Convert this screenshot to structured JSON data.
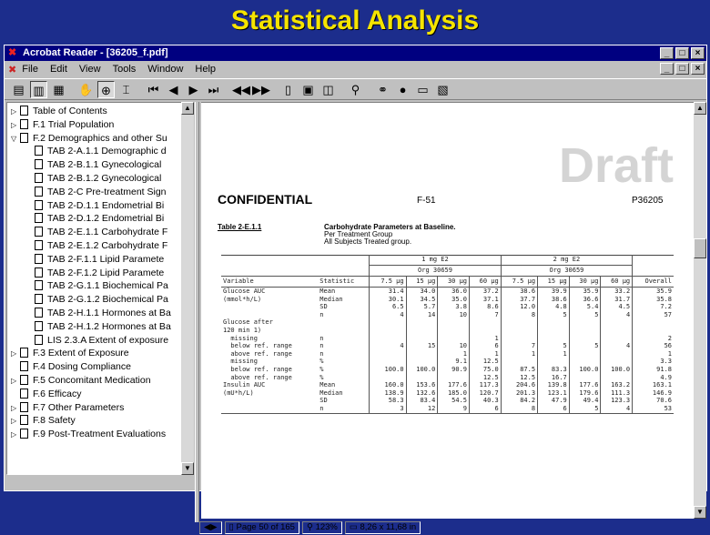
{
  "slide_title": "Statistical Analysis",
  "window": {
    "title": "Acrobat Reader - [36205_f.pdf]",
    "min_label": "_",
    "max_label": "□",
    "close_label": "×"
  },
  "menu": [
    "File",
    "Edit",
    "View",
    "Tools",
    "Window",
    "Help"
  ],
  "bookmarks": [
    {
      "label": "Table of Contents",
      "level": 0,
      "expander": "▷"
    },
    {
      "label": "F.1 Trial Population",
      "level": 0,
      "expander": "▷"
    },
    {
      "label": "F.2 Demographics and other Su",
      "level": 0,
      "expander": "▽"
    },
    {
      "label": "TAB 2-A.1.1 Demographic d",
      "level": 1,
      "expander": ""
    },
    {
      "label": "TAB 2-B.1.1 Gynecological",
      "level": 1,
      "expander": ""
    },
    {
      "label": "TAB 2-B.1.2 Gynecological",
      "level": 1,
      "expander": ""
    },
    {
      "label": "TAB 2-C Pre-treatment Sign",
      "level": 1,
      "expander": ""
    },
    {
      "label": "TAB 2-D.1.1 Endometrial Bi",
      "level": 1,
      "expander": ""
    },
    {
      "label": "TAB 2-D.1.2 Endometrial Bi",
      "level": 1,
      "expander": ""
    },
    {
      "label": "TAB 2-E.1.1 Carbohydrate F",
      "level": 1,
      "expander": ""
    },
    {
      "label": "TAB 2-E.1.2 Carbohydrate F",
      "level": 1,
      "expander": ""
    },
    {
      "label": "TAB 2-F.1.1 Lipid Paramete",
      "level": 1,
      "expander": ""
    },
    {
      "label": "TAB 2-F.1.2 Lipid Paramete",
      "level": 1,
      "expander": ""
    },
    {
      "label": "TAB 2-G.1.1 Biochemical Pa",
      "level": 1,
      "expander": ""
    },
    {
      "label": "TAB 2-G.1.2 Biochemical Pa",
      "level": 1,
      "expander": ""
    },
    {
      "label": "TAB 2-H.1.1 Hormones at Ba",
      "level": 1,
      "expander": ""
    },
    {
      "label": "TAB 2-H.1.2 Hormones at Ba",
      "level": 1,
      "expander": ""
    },
    {
      "label": "LIS 2.3.A Extent of exposure",
      "level": 1,
      "expander": ""
    },
    {
      "label": "F.3 Extent of Exposure",
      "level": 0,
      "expander": "▷"
    },
    {
      "label": "F.4 Dosing Compliance",
      "level": 0,
      "expander": ""
    },
    {
      "label": "F.5 Concomitant Medication",
      "level": 0,
      "expander": "▷"
    },
    {
      "label": "F.6 Efficacy",
      "level": 0,
      "expander": ""
    },
    {
      "label": "F.7 Other Parameters",
      "level": 0,
      "expander": "▷"
    },
    {
      "label": "F.8 Safety",
      "level": 0,
      "expander": "▷"
    },
    {
      "label": "F.9 Post-Treatment Evaluations",
      "level": 0,
      "expander": "▷"
    }
  ],
  "status": {
    "page": "Page 50 of 165",
    "zoom": "123%",
    "size": "8,26 x 11,68 in"
  },
  "doc": {
    "watermark": "Draft",
    "confidential": "CONFIDENTIAL",
    "section": "F-51",
    "study": "P36205",
    "table_id": "Table 2-E.1.1",
    "table_title": "Carbohydrate Parameters at Baseline.",
    "table_sub1": "Per Treatment Group",
    "table_sub2": "All  Subjects  Treated group.",
    "grp1_dose": "1 mg E2",
    "grp2_dose": "2 mg E2",
    "grp1_org": "Org 30659",
    "grp2_org": "Org 30659",
    "col_variable": "Variable",
    "col_statistic": "Statistic",
    "col_doses": [
      "7.5 µg",
      "15 µg",
      "30 µg",
      "60 µg",
      "7.5 µg",
      "15 µg",
      "30 µg",
      "60 µg"
    ],
    "col_overall": "Overall",
    "rows": [
      {
        "var": "Glucose AUC",
        "stat": "Mean",
        "vals": [
          "31.4",
          "34.0",
          "36.0",
          "37.2",
          "38.6",
          "39.9",
          "35.9",
          "33.2"
        ],
        "overall": "35.9"
      },
      {
        "var": "(mmol*h/L)",
        "stat": "Median",
        "vals": [
          "30.1",
          "34.5",
          "35.0",
          "37.1",
          "37.7",
          "38.6",
          "36.6",
          "31.7"
        ],
        "overall": "35.8"
      },
      {
        "var": "",
        "stat": "SD",
        "vals": [
          "6.5",
          "5.7",
          "3.8",
          "8.6",
          "12.0",
          "4.8",
          "5.4",
          "4.5"
        ],
        "overall": "7.2"
      },
      {
        "var": "",
        "stat": "n",
        "vals": [
          "4",
          "14",
          "10",
          "7",
          "8",
          "5",
          "5",
          "4"
        ],
        "overall": "57"
      },
      {
        "var": "Glucose after",
        "stat": "",
        "vals": [
          "",
          "",
          "",
          "",
          "",
          "",
          "",
          ""
        ],
        "overall": ""
      },
      {
        "var": "120 min 1)",
        "stat": "",
        "vals": [
          "",
          "",
          "",
          "",
          "",
          "",
          "",
          ""
        ],
        "overall": ""
      },
      {
        "var": "  missing",
        "stat": "n",
        "vals": [
          "",
          "",
          "",
          "1",
          "",
          "",
          "",
          ""
        ],
        "overall": "2"
      },
      {
        "var": "  below ref. range",
        "stat": "n",
        "vals": [
          "4",
          "15",
          "10",
          "6",
          "7",
          "5",
          "5",
          "4"
        ],
        "overall": "56"
      },
      {
        "var": "  above ref. range",
        "stat": "n",
        "vals": [
          "",
          "",
          "1",
          "1",
          "1",
          "1",
          "",
          ""
        ],
        "overall": "1"
      },
      {
        "var": "  missing",
        "stat": "%",
        "vals": [
          "",
          "",
          "9.1",
          "12.5",
          "",
          "",
          "",
          ""
        ],
        "overall": "3.3"
      },
      {
        "var": "  below ref. range",
        "stat": "%",
        "vals": [
          "100.0",
          "100.0",
          "90.9",
          "75.0",
          "87.5",
          "83.3",
          "100.0",
          "100.0"
        ],
        "overall": "91.8"
      },
      {
        "var": "  above ref. range",
        "stat": "%",
        "vals": [
          "",
          "",
          "",
          "12.5",
          "12.5",
          "16.7",
          "",
          ""
        ],
        "overall": "4.9"
      },
      {
        "var": "",
        "stat": "",
        "vals": [
          "",
          "",
          "",
          "",
          "",
          "",
          "",
          ""
        ],
        "overall": ""
      },
      {
        "var": "Insulin AUC",
        "stat": "Mean",
        "vals": [
          "160.0",
          "153.6",
          "177.6",
          "117.3",
          "204.6",
          "139.8",
          "177.6",
          "163.2"
        ],
        "overall": "163.1"
      },
      {
        "var": "(mU*h/L)",
        "stat": "Median",
        "vals": [
          "138.9",
          "132.6",
          "185.0",
          "120.7",
          "201.3",
          "123.1",
          "179.6",
          "111.3"
        ],
        "overall": "146.9"
      },
      {
        "var": "",
        "stat": "SD",
        "vals": [
          "58.3",
          "83.4",
          "54.5",
          "40.3",
          "84.2",
          "47.9",
          "49.4",
          "123.3"
        ],
        "overall": "70.6"
      },
      {
        "var": "",
        "stat": "n",
        "vals": [
          "3",
          "12",
          "9",
          "6",
          "8",
          "6",
          "5",
          "4"
        ],
        "overall": "53"
      }
    ]
  }
}
